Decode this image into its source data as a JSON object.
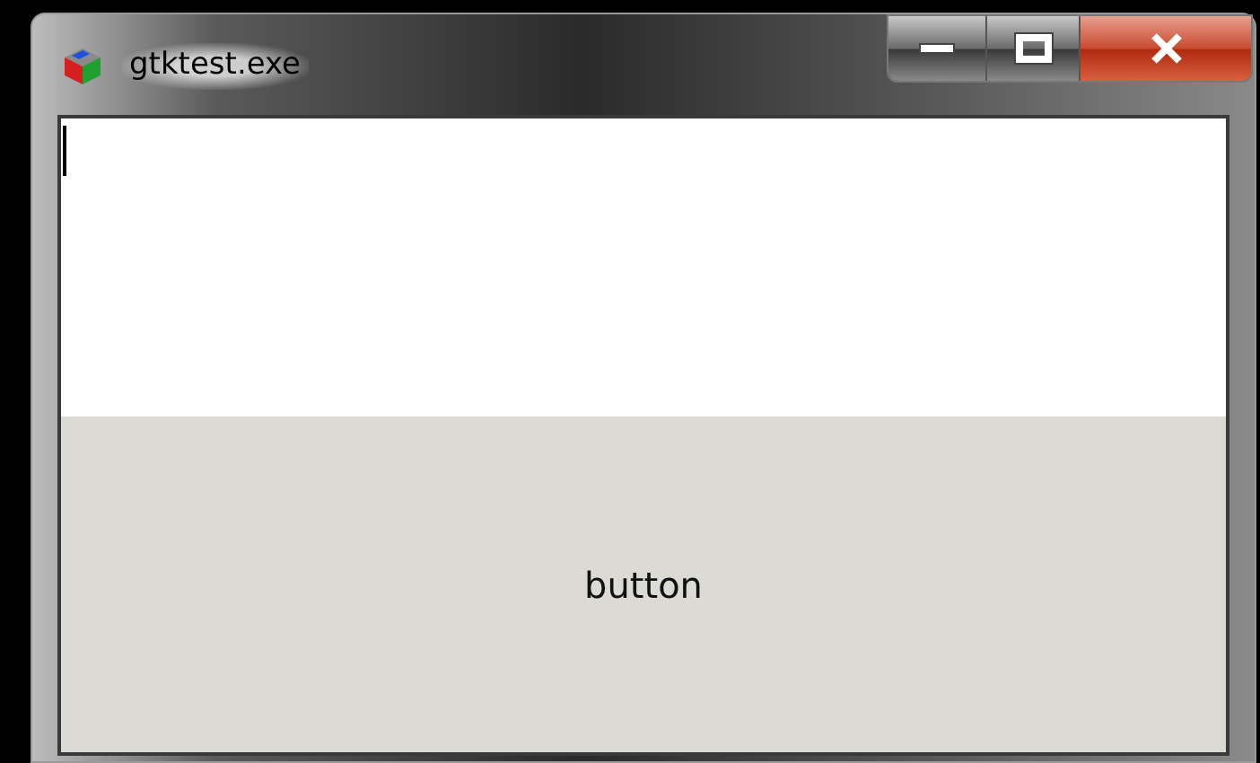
{
  "window": {
    "title": "gtktest.exe"
  },
  "text_view": {
    "focused": true
  },
  "button": {
    "label": "button"
  }
}
